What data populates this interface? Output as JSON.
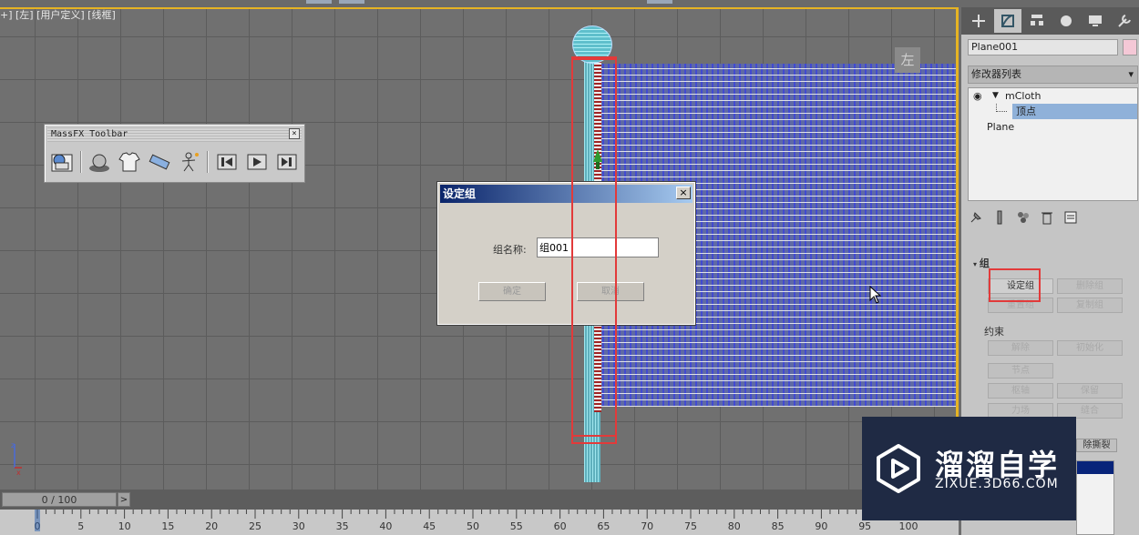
{
  "viewport": {
    "label": "+] [左] [用户定义] [线框]",
    "view_cube_label": "左"
  },
  "massfx_toolbar": {
    "title": "MassFX Toolbar",
    "close": "×"
  },
  "dialog": {
    "title": "设定组",
    "close": "×",
    "group_name_label": "组名称:",
    "group_name_value": "组001",
    "ok_label": "确定",
    "cancel_label": "取消"
  },
  "panel": {
    "object_name": "Plane001",
    "object_color": "#f4c8d6",
    "modifier_list": "修改器列表",
    "stack": {
      "modifier": "mCloth",
      "sub_object": "顶点",
      "base": "Plane"
    },
    "rollout": {
      "header": "组",
      "set_group": "设定组",
      "delete_group": "删除组",
      "detach": "重置组",
      "copy_group": "复制组",
      "constraints_label": "约束",
      "remove": "解除",
      "initialize": "初始化",
      "node": "节点",
      "pivot": "枢轴",
      "preserve": "保留",
      "force": "力场",
      "stitch": "缝合",
      "remove_tear": "除撕裂"
    }
  },
  "timeline": {
    "frame": "0 / 100",
    "next": ">",
    "ticks": [
      "0",
      "5",
      "10",
      "15",
      "20",
      "25",
      "30",
      "35",
      "40",
      "45",
      "50",
      "55",
      "60",
      "65",
      "70",
      "75",
      "80",
      "85",
      "90",
      "95",
      "100"
    ]
  },
  "watermark": {
    "brand_cn": "溜溜自学",
    "brand_url": "ZIXUE.3D66.COM"
  },
  "colors": {
    "highlight_red": "#e23a3a",
    "active_viewport_border": "#e6b323",
    "dialog_title": "#0a246a"
  }
}
